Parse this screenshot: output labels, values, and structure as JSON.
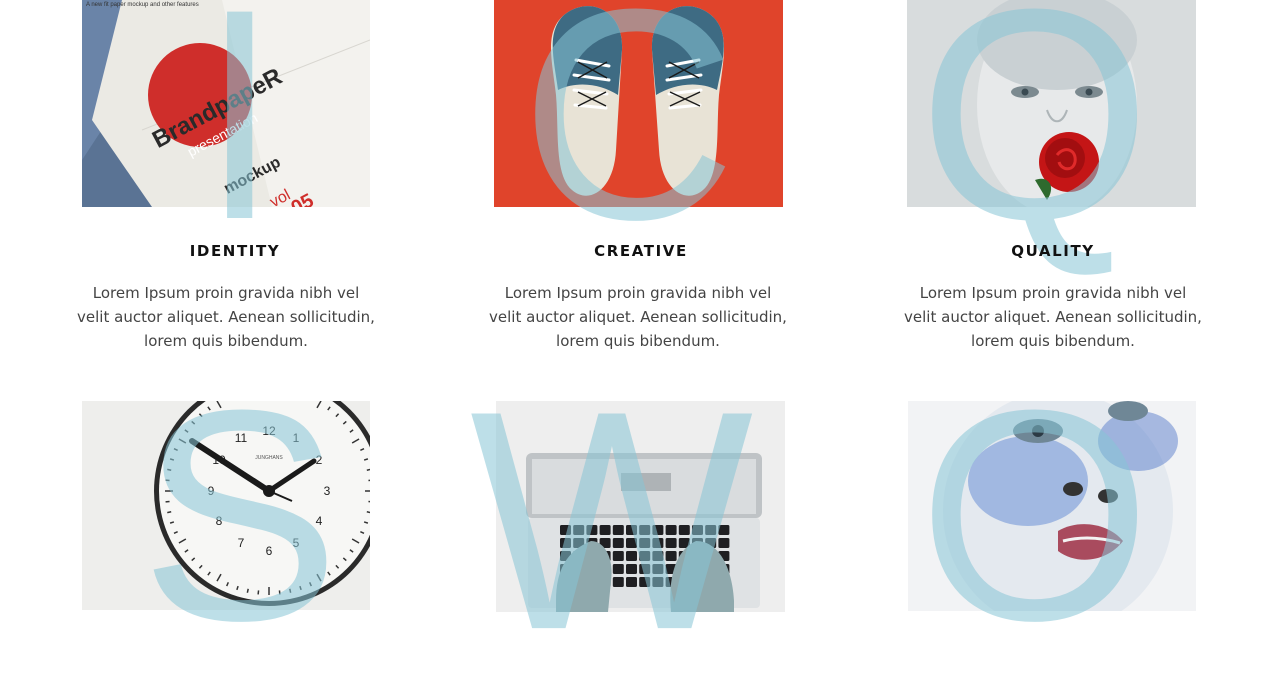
{
  "features": [
    {
      "letter": "I",
      "title": "IDENTITY",
      "description": "Lorem Ipsum proin gravida nibh vel velit auctor aliquet. Aenean sollicitudin, lorem quis bibendum.",
      "image": "brand-paper-mockup",
      "mockup": {
        "tiny": "A new fit paper mockup and other features",
        "brand": "BrandpapeR",
        "sub": "presentation",
        "mockup": "mockup",
        "vol": "vol",
        "num": "05"
      }
    },
    {
      "letter": "C",
      "title": "CREATIVE",
      "description": "Lorem Ipsum proin gravida nibh vel velit auctor aliquet. Aenean sollicitudin, lorem quis bibendum.",
      "image": "sneakers-on-red"
    },
    {
      "letter": "Q",
      "title": "QUALITY",
      "description": "Lorem Ipsum proin gravida nibh vel velit auctor aliquet. Aenean sollicitudin, lorem quis bibendum.",
      "image": "face-with-rose"
    },
    {
      "letter": "S",
      "image": "wall-clock",
      "clock": {
        "n12": "12",
        "n1": "1",
        "n2": "2",
        "n3": "3",
        "n4": "4",
        "n5": "5",
        "n6": "6",
        "n7": "7",
        "n8": "8",
        "n9": "9",
        "n10": "10",
        "n11": "11",
        "brand": "JUNGHANS"
      }
    },
    {
      "letter": "W",
      "image": "laptop-typing"
    },
    {
      "letter": "O",
      "image": "painted-face"
    }
  ],
  "colors": {
    "letter_overlay": "#87c4d6",
    "title": "#111111",
    "text": "#444444",
    "red": "#e0442b"
  }
}
